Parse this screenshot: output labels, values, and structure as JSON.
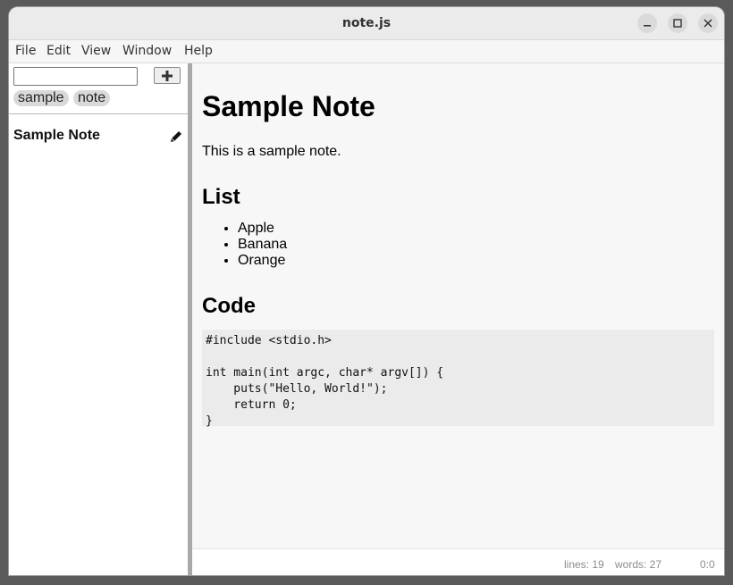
{
  "window": {
    "title": "note.js"
  },
  "menu": {
    "items": [
      "File",
      "Edit",
      "View",
      "Window",
      "Help"
    ]
  },
  "sidebar": {
    "search": {
      "value": "",
      "placeholder": ""
    },
    "add_icon": "plus-icon",
    "tags": [
      "sample",
      "note"
    ],
    "notes": [
      {
        "title": "Sample Note",
        "edit_icon": "pencil-icon"
      }
    ]
  },
  "note": {
    "heading": "Sample Note",
    "paragraph": "This is a sample note.",
    "list_heading": "List",
    "list_items": [
      "Apple",
      "Banana",
      "Orange"
    ],
    "code_heading": "Code",
    "code": "#include <stdio.h>\n\nint main(int argc, char* argv[]) {\n    puts(\"Hello, World!\");\n    return 0;\n}"
  },
  "status": {
    "lines": "lines: 19",
    "words": "words: 27",
    "cursor": "0:0"
  },
  "colors": {
    "sidebar_bg": "#ffffff",
    "content_bg": "#f7f7f7",
    "tag_bg": "#d9d9d9",
    "code_bg": "#ebebeb",
    "splitter": "#a9a9a9"
  }
}
